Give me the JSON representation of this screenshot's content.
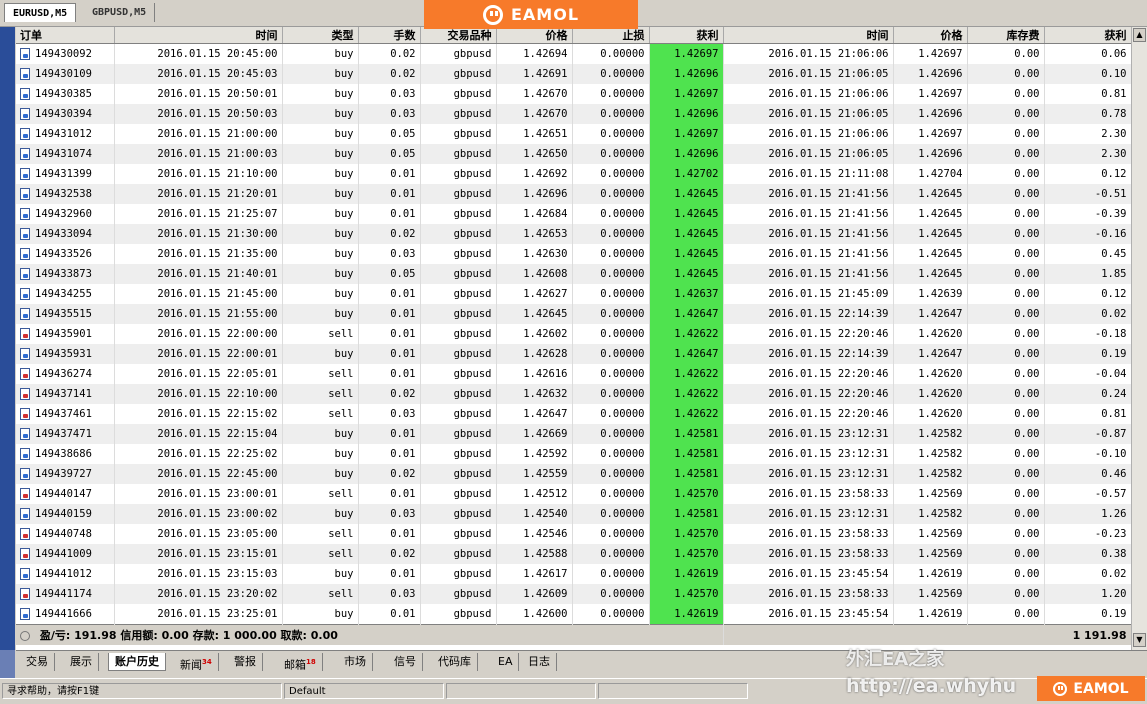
{
  "chart_tabs": [
    "EURUSD,M5",
    "GBPUSD,M5"
  ],
  "brand": "EAMOL",
  "columns": [
    "订单",
    "时间",
    "类型",
    "手数",
    "交易品种",
    "价格",
    "止损",
    "获利",
    "时间",
    "价格",
    "库存费",
    "获利"
  ],
  "orders": [
    {
      "order": "149430092",
      "open_time": "2016.01.15 20:45:00",
      "type": "buy",
      "lots": "0.02",
      "symbol": "gbpusd",
      "price": "1.42694",
      "sl": "0.00000",
      "tp": "1.42697",
      "close_time": "2016.01.15 21:06:06",
      "close_price": "1.42697",
      "swap": "0.00",
      "profit": "0.06"
    },
    {
      "order": "149430109",
      "open_time": "2016.01.15 20:45:03",
      "type": "buy",
      "lots": "0.02",
      "symbol": "gbpusd",
      "price": "1.42691",
      "sl": "0.00000",
      "tp": "1.42696",
      "close_time": "2016.01.15 21:06:05",
      "close_price": "1.42696",
      "swap": "0.00",
      "profit": "0.10"
    },
    {
      "order": "149430385",
      "open_time": "2016.01.15 20:50:01",
      "type": "buy",
      "lots": "0.03",
      "symbol": "gbpusd",
      "price": "1.42670",
      "sl": "0.00000",
      "tp": "1.42697",
      "close_time": "2016.01.15 21:06:06",
      "close_price": "1.42697",
      "swap": "0.00",
      "profit": "0.81"
    },
    {
      "order": "149430394",
      "open_time": "2016.01.15 20:50:03",
      "type": "buy",
      "lots": "0.03",
      "symbol": "gbpusd",
      "price": "1.42670",
      "sl": "0.00000",
      "tp": "1.42696",
      "close_time": "2016.01.15 21:06:05",
      "close_price": "1.42696",
      "swap": "0.00",
      "profit": "0.78"
    },
    {
      "order": "149431012",
      "open_time": "2016.01.15 21:00:00",
      "type": "buy",
      "lots": "0.05",
      "symbol": "gbpusd",
      "price": "1.42651",
      "sl": "0.00000",
      "tp": "1.42697",
      "close_time": "2016.01.15 21:06:06",
      "close_price": "1.42697",
      "swap": "0.00",
      "profit": "2.30"
    },
    {
      "order": "149431074",
      "open_time": "2016.01.15 21:00:03",
      "type": "buy",
      "lots": "0.05",
      "symbol": "gbpusd",
      "price": "1.42650",
      "sl": "0.00000",
      "tp": "1.42696",
      "close_time": "2016.01.15 21:06:05",
      "close_price": "1.42696",
      "swap": "0.00",
      "profit": "2.30"
    },
    {
      "order": "149431399",
      "open_time": "2016.01.15 21:10:00",
      "type": "buy",
      "lots": "0.01",
      "symbol": "gbpusd",
      "price": "1.42692",
      "sl": "0.00000",
      "tp": "1.42702",
      "close_time": "2016.01.15 21:11:08",
      "close_price": "1.42704",
      "swap": "0.00",
      "profit": "0.12"
    },
    {
      "order": "149432538",
      "open_time": "2016.01.15 21:20:01",
      "type": "buy",
      "lots": "0.01",
      "symbol": "gbpusd",
      "price": "1.42696",
      "sl": "0.00000",
      "tp": "1.42645",
      "close_time": "2016.01.15 21:41:56",
      "close_price": "1.42645",
      "swap": "0.00",
      "profit": "-0.51"
    },
    {
      "order": "149432960",
      "open_time": "2016.01.15 21:25:07",
      "type": "buy",
      "lots": "0.01",
      "symbol": "gbpusd",
      "price": "1.42684",
      "sl": "0.00000",
      "tp": "1.42645",
      "close_time": "2016.01.15 21:41:56",
      "close_price": "1.42645",
      "swap": "0.00",
      "profit": "-0.39"
    },
    {
      "order": "149433094",
      "open_time": "2016.01.15 21:30:00",
      "type": "buy",
      "lots": "0.02",
      "symbol": "gbpusd",
      "price": "1.42653",
      "sl": "0.00000",
      "tp": "1.42645",
      "close_time": "2016.01.15 21:41:56",
      "close_price": "1.42645",
      "swap": "0.00",
      "profit": "-0.16"
    },
    {
      "order": "149433526",
      "open_time": "2016.01.15 21:35:00",
      "type": "buy",
      "lots": "0.03",
      "symbol": "gbpusd",
      "price": "1.42630",
      "sl": "0.00000",
      "tp": "1.42645",
      "close_time": "2016.01.15 21:41:56",
      "close_price": "1.42645",
      "swap": "0.00",
      "profit": "0.45"
    },
    {
      "order": "149433873",
      "open_time": "2016.01.15 21:40:01",
      "type": "buy",
      "lots": "0.05",
      "symbol": "gbpusd",
      "price": "1.42608",
      "sl": "0.00000",
      "tp": "1.42645",
      "close_time": "2016.01.15 21:41:56",
      "close_price": "1.42645",
      "swap": "0.00",
      "profit": "1.85"
    },
    {
      "order": "149434255",
      "open_time": "2016.01.15 21:45:00",
      "type": "buy",
      "lots": "0.01",
      "symbol": "gbpusd",
      "price": "1.42627",
      "sl": "0.00000",
      "tp": "1.42637",
      "close_time": "2016.01.15 21:45:09",
      "close_price": "1.42639",
      "swap": "0.00",
      "profit": "0.12"
    },
    {
      "order": "149435515",
      "open_time": "2016.01.15 21:55:00",
      "type": "buy",
      "lots": "0.01",
      "symbol": "gbpusd",
      "price": "1.42645",
      "sl": "0.00000",
      "tp": "1.42647",
      "close_time": "2016.01.15 22:14:39",
      "close_price": "1.42647",
      "swap": "0.00",
      "profit": "0.02"
    },
    {
      "order": "149435901",
      "open_time": "2016.01.15 22:00:00",
      "type": "sell",
      "lots": "0.01",
      "symbol": "gbpusd",
      "price": "1.42602",
      "sl": "0.00000",
      "tp": "1.42622",
      "close_time": "2016.01.15 22:20:46",
      "close_price": "1.42620",
      "swap": "0.00",
      "profit": "-0.18"
    },
    {
      "order": "149435931",
      "open_time": "2016.01.15 22:00:01",
      "type": "buy",
      "lots": "0.01",
      "symbol": "gbpusd",
      "price": "1.42628",
      "sl": "0.00000",
      "tp": "1.42647",
      "close_time": "2016.01.15 22:14:39",
      "close_price": "1.42647",
      "swap": "0.00",
      "profit": "0.19"
    },
    {
      "order": "149436274",
      "open_time": "2016.01.15 22:05:01",
      "type": "sell",
      "lots": "0.01",
      "symbol": "gbpusd",
      "price": "1.42616",
      "sl": "0.00000",
      "tp": "1.42622",
      "close_time": "2016.01.15 22:20:46",
      "close_price": "1.42620",
      "swap": "0.00",
      "profit": "-0.04"
    },
    {
      "order": "149437141",
      "open_time": "2016.01.15 22:10:00",
      "type": "sell",
      "lots": "0.02",
      "symbol": "gbpusd",
      "price": "1.42632",
      "sl": "0.00000",
      "tp": "1.42622",
      "close_time": "2016.01.15 22:20:46",
      "close_price": "1.42620",
      "swap": "0.00",
      "profit": "0.24"
    },
    {
      "order": "149437461",
      "open_time": "2016.01.15 22:15:02",
      "type": "sell",
      "lots": "0.03",
      "symbol": "gbpusd",
      "price": "1.42647",
      "sl": "0.00000",
      "tp": "1.42622",
      "close_time": "2016.01.15 22:20:46",
      "close_price": "1.42620",
      "swap": "0.00",
      "profit": "0.81"
    },
    {
      "order": "149437471",
      "open_time": "2016.01.15 22:15:04",
      "type": "buy",
      "lots": "0.01",
      "symbol": "gbpusd",
      "price": "1.42669",
      "sl": "0.00000",
      "tp": "1.42581",
      "close_time": "2016.01.15 23:12:31",
      "close_price": "1.42582",
      "swap": "0.00",
      "profit": "-0.87"
    },
    {
      "order": "149438686",
      "open_time": "2016.01.15 22:25:02",
      "type": "buy",
      "lots": "0.01",
      "symbol": "gbpusd",
      "price": "1.42592",
      "sl": "0.00000",
      "tp": "1.42581",
      "close_time": "2016.01.15 23:12:31",
      "close_price": "1.42582",
      "swap": "0.00",
      "profit": "-0.10"
    },
    {
      "order": "149439727",
      "open_time": "2016.01.15 22:45:00",
      "type": "buy",
      "lots": "0.02",
      "symbol": "gbpusd",
      "price": "1.42559",
      "sl": "0.00000",
      "tp": "1.42581",
      "close_time": "2016.01.15 23:12:31",
      "close_price": "1.42582",
      "swap": "0.00",
      "profit": "0.46"
    },
    {
      "order": "149440147",
      "open_time": "2016.01.15 23:00:01",
      "type": "sell",
      "lots": "0.01",
      "symbol": "gbpusd",
      "price": "1.42512",
      "sl": "0.00000",
      "tp": "1.42570",
      "close_time": "2016.01.15 23:58:33",
      "close_price": "1.42569",
      "swap": "0.00",
      "profit": "-0.57"
    },
    {
      "order": "149440159",
      "open_time": "2016.01.15 23:00:02",
      "type": "buy",
      "lots": "0.03",
      "symbol": "gbpusd",
      "price": "1.42540",
      "sl": "0.00000",
      "tp": "1.42581",
      "close_time": "2016.01.15 23:12:31",
      "close_price": "1.42582",
      "swap": "0.00",
      "profit": "1.26"
    },
    {
      "order": "149440748",
      "open_time": "2016.01.15 23:05:00",
      "type": "sell",
      "lots": "0.01",
      "symbol": "gbpusd",
      "price": "1.42546",
      "sl": "0.00000",
      "tp": "1.42570",
      "close_time": "2016.01.15 23:58:33",
      "close_price": "1.42569",
      "swap": "0.00",
      "profit": "-0.23"
    },
    {
      "order": "149441009",
      "open_time": "2016.01.15 23:15:01",
      "type": "sell",
      "lots": "0.02",
      "symbol": "gbpusd",
      "price": "1.42588",
      "sl": "0.00000",
      "tp": "1.42570",
      "close_time": "2016.01.15 23:58:33",
      "close_price": "1.42569",
      "swap": "0.00",
      "profit": "0.38"
    },
    {
      "order": "149441012",
      "open_time": "2016.01.15 23:15:03",
      "type": "buy",
      "lots": "0.01",
      "symbol": "gbpusd",
      "price": "1.42617",
      "sl": "0.00000",
      "tp": "1.42619",
      "close_time": "2016.01.15 23:45:54",
      "close_price": "1.42619",
      "swap": "0.00",
      "profit": "0.02"
    },
    {
      "order": "149441174",
      "open_time": "2016.01.15 23:20:02",
      "type": "sell",
      "lots": "0.03",
      "symbol": "gbpusd",
      "price": "1.42609",
      "sl": "0.00000",
      "tp": "1.42570",
      "close_time": "2016.01.15 23:58:33",
      "close_price": "1.42569",
      "swap": "0.00",
      "profit": "1.20"
    },
    {
      "order": "149441666",
      "open_time": "2016.01.15 23:25:01",
      "type": "buy",
      "lots": "0.01",
      "symbol": "gbpusd",
      "price": "1.42600",
      "sl": "0.00000",
      "tp": "1.42619",
      "close_time": "2016.01.15 23:45:54",
      "close_price": "1.42619",
      "swap": "0.00",
      "profit": "0.19"
    }
  ],
  "summary": {
    "text": "盈/亏: 191.98  信用额: 0.00  存款: 1 000.00  取款: 0.00",
    "total": "1 191.98"
  },
  "bottom_tabs": [
    {
      "label": "交易",
      "badge": ""
    },
    {
      "label": "展示",
      "badge": ""
    },
    {
      "label": "账户历史",
      "badge": ""
    },
    {
      "label": "新闻",
      "badge": "34"
    },
    {
      "label": "警报",
      "badge": ""
    },
    {
      "label": "邮箱",
      "badge": "18"
    },
    {
      "label": "市场",
      "badge": ""
    },
    {
      "label": "信号",
      "badge": ""
    },
    {
      "label": "代码库",
      "badge": ""
    },
    {
      "label": "EA",
      "badge": ""
    },
    {
      "label": "日志",
      "badge": ""
    }
  ],
  "status_bar": {
    "help_text": "寻求帮助，请按F1键",
    "profile": "Default"
  },
  "watermark": {
    "title": "外汇EA之家",
    "url": "http://ea.whyhu"
  },
  "colors": {
    "tp_highlight": "#4fe34f",
    "brand_orange": "#f77a2a",
    "buy_icon": "#2f6bd0",
    "sell_icon": "#d02f2f"
  }
}
